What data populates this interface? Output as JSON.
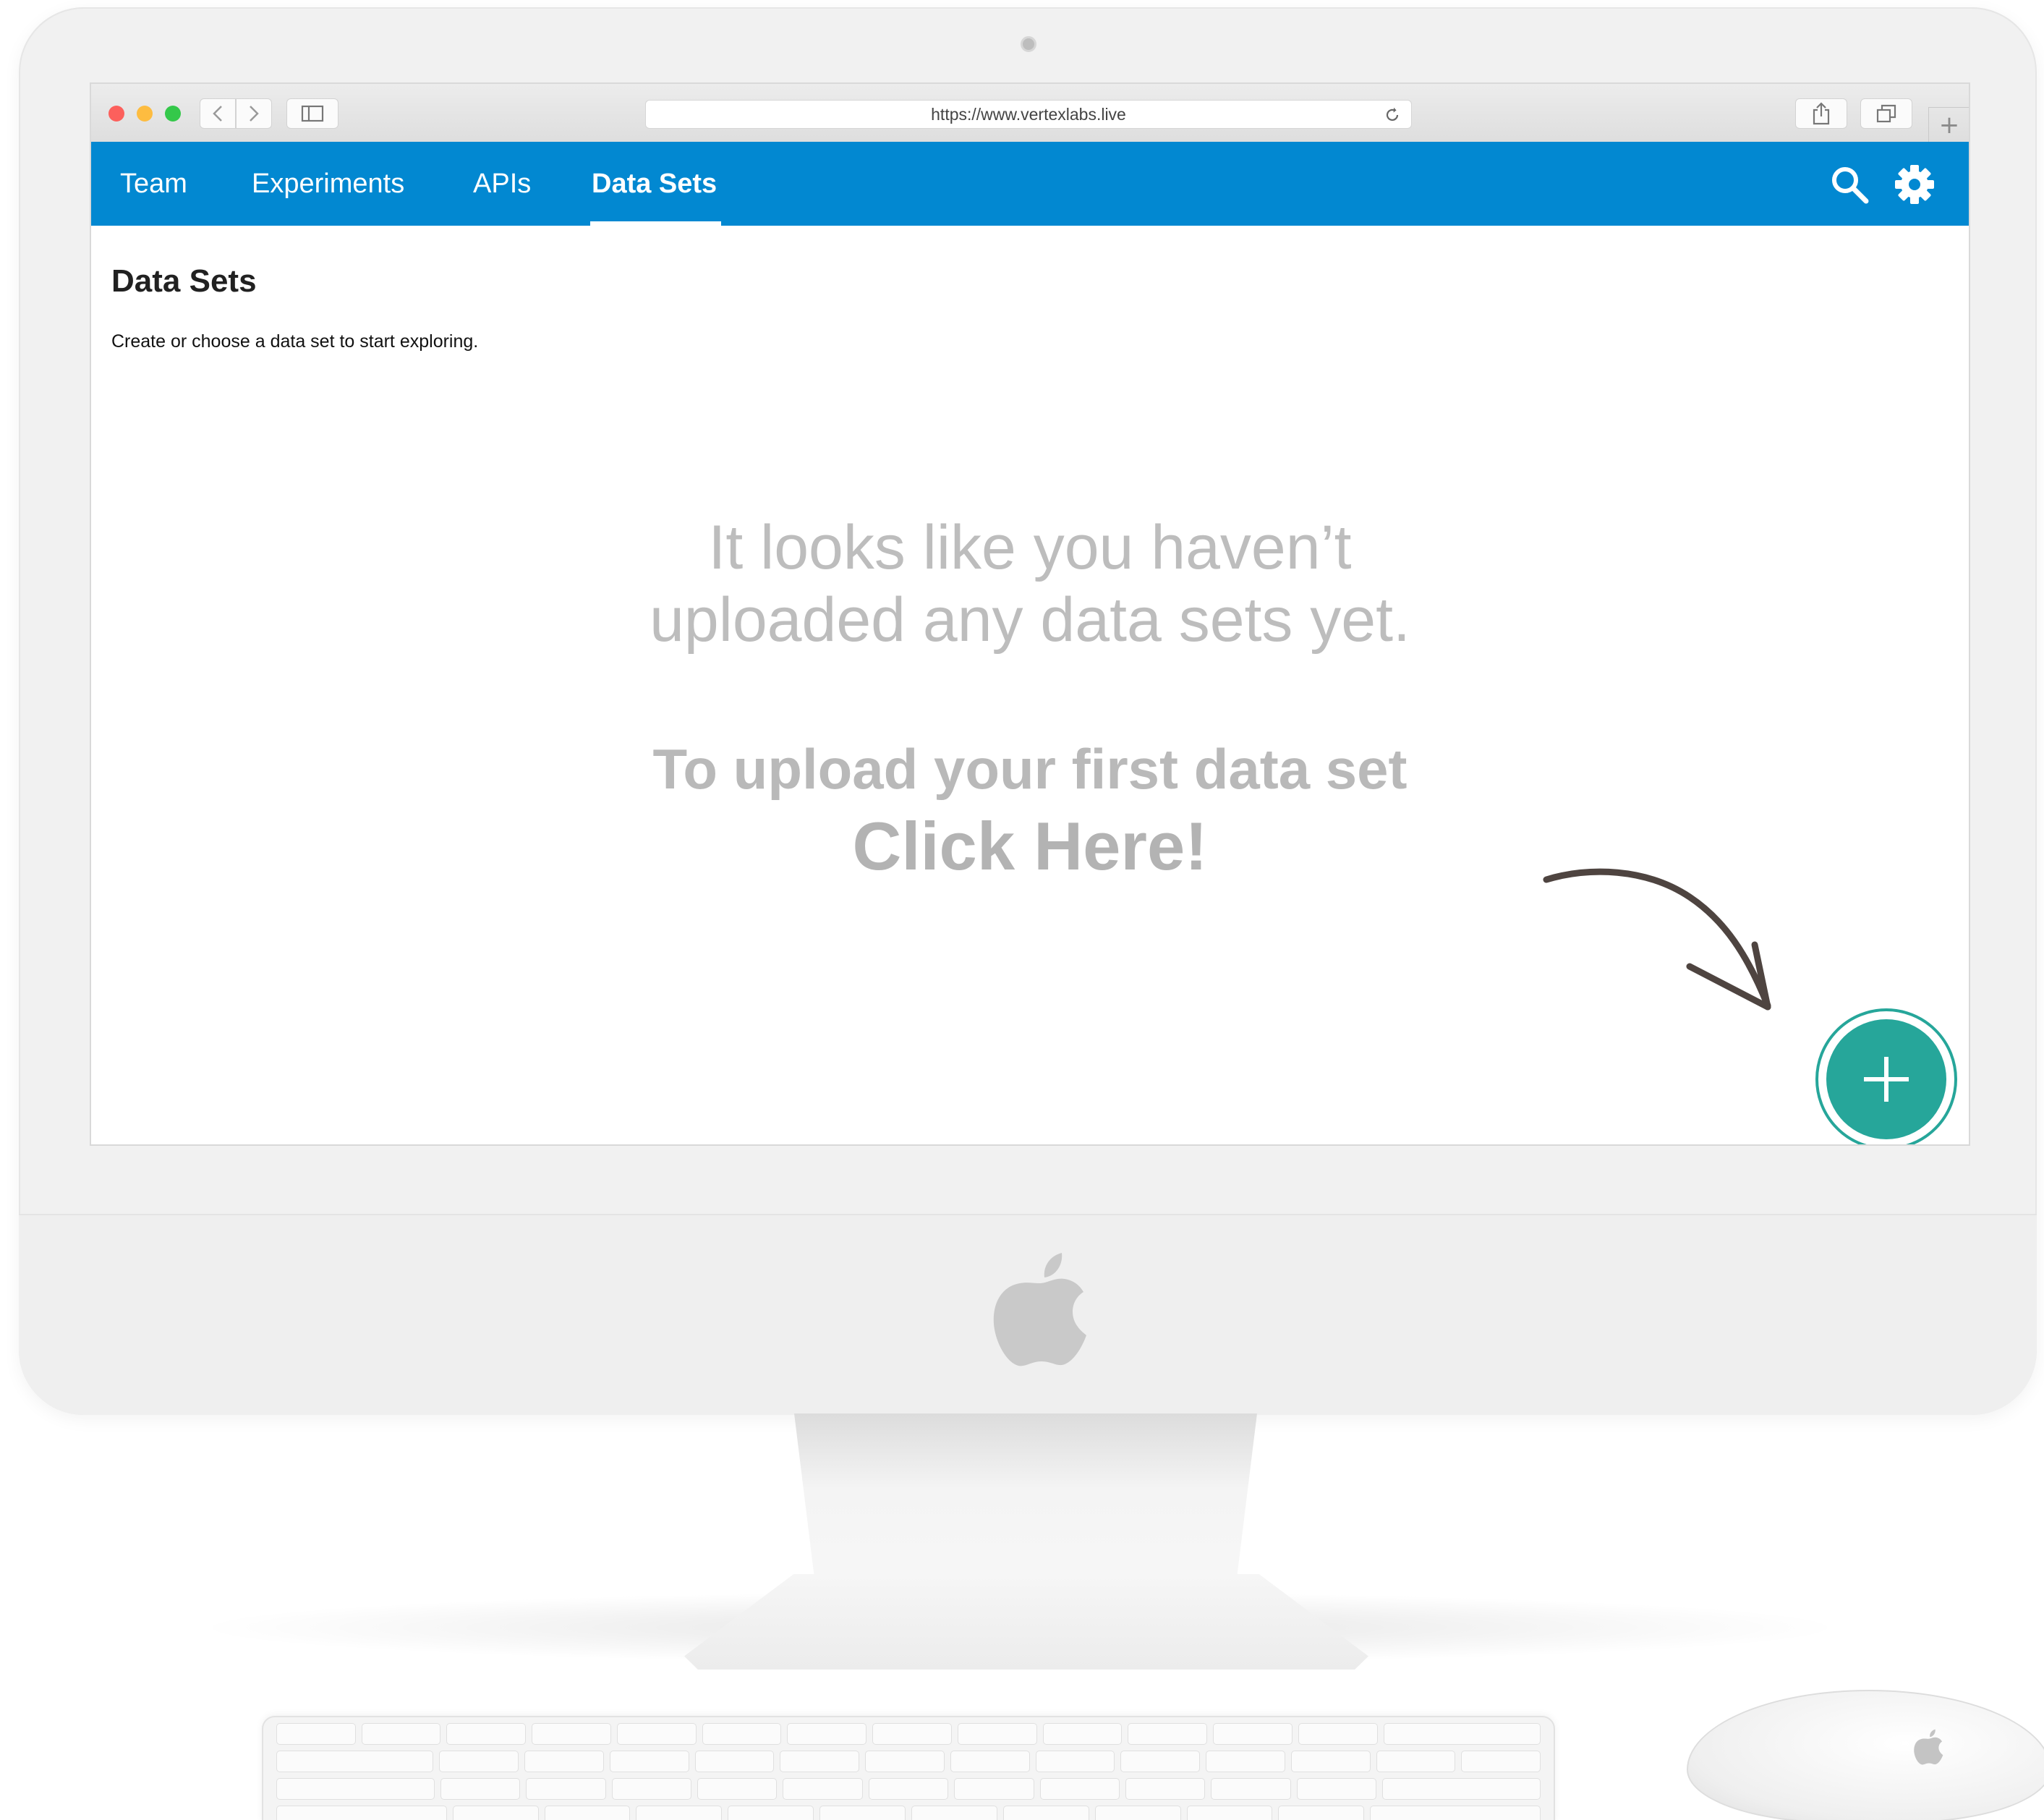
{
  "browser": {
    "url": "https://www.vertexlabs.live",
    "new_tab_label": "+"
  },
  "nav": {
    "tabs": [
      {
        "label": "Team"
      },
      {
        "label": "Experiments"
      },
      {
        "label": "APIs"
      },
      {
        "label": "Data Sets",
        "active": true
      }
    ],
    "icons": [
      "search-icon",
      "gear-icon"
    ]
  },
  "page": {
    "title": "Data Sets",
    "subtitle": "Create or choose a data set to start exploring.",
    "empty_line1": "It looks like you haven’t",
    "empty_line2": "uploaded any data sets yet.",
    "upload_prompt": "To upload your first data set",
    "click_here": "Click Here!"
  },
  "fab": {
    "icon": "plus-icon"
  },
  "colors": {
    "nav_bar": "#0288d1",
    "fab": "#26a69a",
    "empty_text": "#bdbdbd",
    "arrow": "#4e4440"
  }
}
